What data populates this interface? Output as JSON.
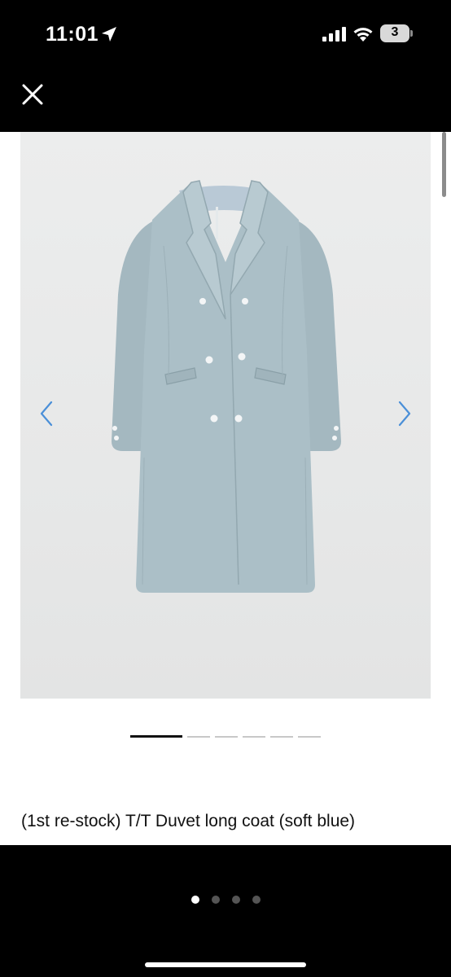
{
  "status_bar": {
    "time": "11:01",
    "battery_level": "3"
  },
  "nav": {
    "close_icon": "close-icon"
  },
  "product": {
    "title": "(1st re-stock) T/T Duvet long coat (soft blue)",
    "image_description_icon": "coat-photo",
    "carousel_slide_count": 6,
    "carousel_active_index": 0
  },
  "pager": {
    "page_count": 4,
    "active_page": 0
  },
  "colors": {
    "coat": "#a9bec6",
    "background": "#e9eaea",
    "arrow": "#4a8fd8"
  }
}
